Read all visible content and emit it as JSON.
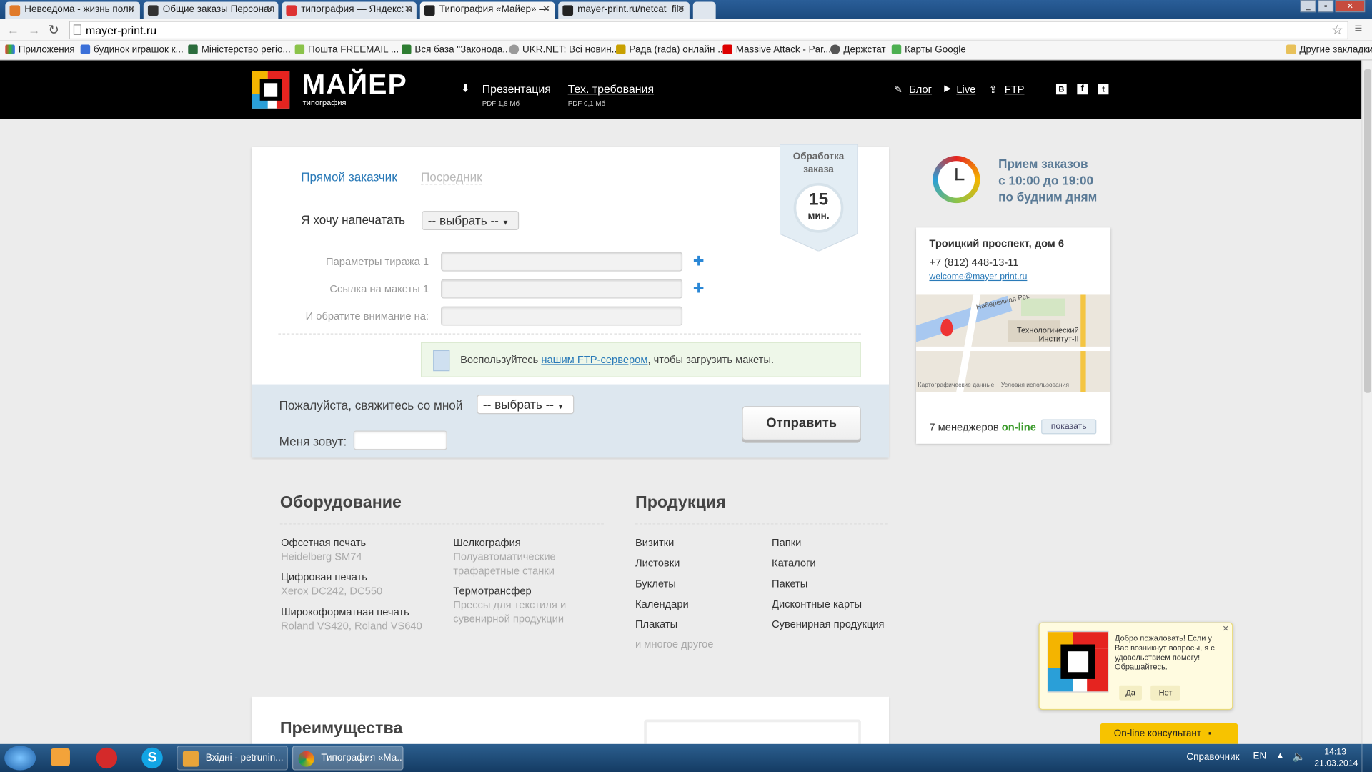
{
  "browser": {
    "tabs": [
      {
        "label": "Невседома - жизнь полн",
        "color": "#e07a2a"
      },
      {
        "label": "Общие заказы Персонал",
        "color": "#333333"
      },
      {
        "label": "типография — Яндекс: н",
        "color": "#d33"
      },
      {
        "label": "Типография «Майер» —",
        "color": "#222222"
      },
      {
        "label": "mayer-print.ru/netcat_file",
        "color": "#222222"
      }
    ],
    "url": "mayer-print.ru",
    "bookmarks": [
      "Приложения",
      "будинок иrpaшок к...",
      "Міністерство регіо...",
      "Пошта FREEMAIL ...",
      "Вся база \"Законода...",
      "UKR.NET: Всі новин...",
      "Рада (rada) онлайн ...",
      "Massive Attack - Par...",
      "Держстат",
      "Карты Google"
    ],
    "other_bookmarks": "Другие закладки"
  },
  "header": {
    "logo_title": "МАЙЕР",
    "logo_sub": "типография",
    "presentation_label": "Презентация",
    "presentation_meta": "PDF 1,8 Мб",
    "tech_label": "Тех. требования",
    "tech_meta": "PDF 0,1 Мб",
    "blog_label": "Блог",
    "live_label": "Live",
    "ftp_label": "FTP"
  },
  "order": {
    "tab_direct": "Прямой заказчик",
    "tab_agent": "Посредник",
    "want_label": "Я хочу напечатать",
    "want_select": "-- выбрать --",
    "processing_label": "Обработка заказа",
    "processing_value": "15",
    "processing_unit": "мин.",
    "field1_label": "Параметры тиража 1",
    "field2_label": "Ссылка на макеты 1",
    "field3_label": "И обратите внимание на:",
    "ftp_prefix": "Воспользуйтесь ",
    "ftp_link": "нашим FTP-сервером",
    "ftp_suffix": ", чтобы загрузить макеты.",
    "contact_label": "Пожалуйста, свяжитесь со мной",
    "contact_select": "-- выбрать --",
    "name_label": "Меня зовут:",
    "submit_label": "Отправить"
  },
  "info": {
    "hours_line1": "Прием заказов",
    "hours_line2": "с 10:00 до 19:00",
    "hours_line3": "по будним дням",
    "address": "Троицкий проспект, дом 6",
    "phone": "+7 (812) 448-13-11",
    "email": "welcome@mayer-print.ru",
    "map_label1": "Технологический",
    "map_label2": "Институт-II",
    "map_street": "Набережная Рек",
    "map_footer1": "Картографические данные",
    "map_footer2": "Условия использования",
    "managers_prefix": "7 менеджеров ",
    "managers_online": "on-line",
    "show_button": "показать"
  },
  "equipment": {
    "title": "Оборудование",
    "left": [
      {
        "name": "Офсетная печать",
        "desc": "Heidelberg SM74"
      },
      {
        "name": "Цифровая печать",
        "desc": "Xerox DC242, DC550"
      },
      {
        "name": "Широкоформатная печать",
        "desc": "Roland VS420, Roland VS640"
      }
    ],
    "right": [
      {
        "name": "Шелкография",
        "desc1": "Полуавтоматические",
        "desc2": "трафаретные станки"
      },
      {
        "name": "Термотрансфер",
        "desc1": "Прессы для текстиля и",
        "desc2": "сувенирной продукции"
      }
    ]
  },
  "products": {
    "title": "Продукция",
    "left": [
      "Визитки",
      "Листовки",
      "Буклеты",
      "Календари",
      "Плакаты"
    ],
    "more": "и многое другое",
    "right": [
      "Папки",
      "Каталоги",
      "Пакеты",
      "Дисконтные карты",
      "Сувенирная продукция"
    ]
  },
  "advantages_title": "Преимущества",
  "chat": {
    "message": "Добро пожаловать! Если у Вас возникнут вопросы, я с удовольствием помогу! Обращайтесь.",
    "yes": "Да",
    "no": "Нет",
    "consultant": "On-line консультант"
  },
  "taskbar": {
    "outlook": "Вхідні - petrunin...",
    "chrome": "Типография «Ма...",
    "toolbar_label": "Справочник",
    "lang": "EN",
    "time": "14:13",
    "date": "21.03.2014"
  }
}
